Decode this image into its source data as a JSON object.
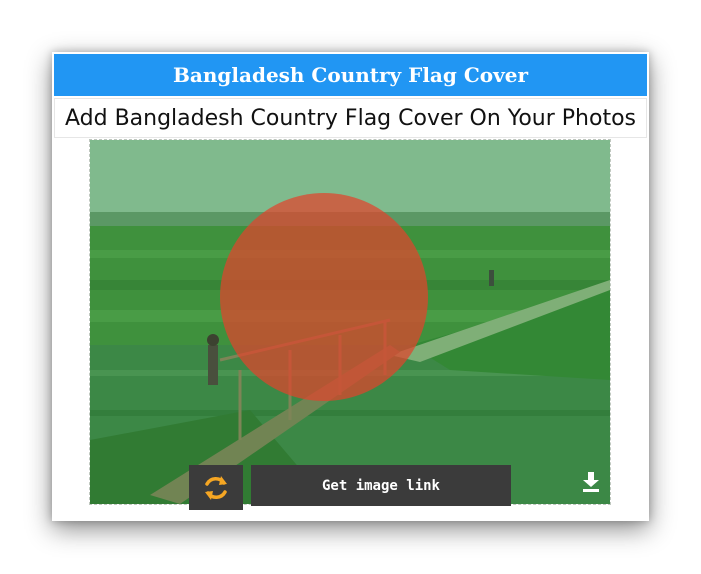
{
  "header": {
    "title": "Bangladesh Country Flag Cover"
  },
  "subtitle": {
    "text": "Add Bangladesh Country Flag Cover On Your Photos"
  },
  "preview": {
    "icons": {
      "download": "download-icon",
      "refresh": "refresh-icon"
    },
    "colors": {
      "overlay_green": "#006a4e",
      "circle_red": "#f42a41"
    }
  },
  "actions": {
    "get_link_label": "Get image link"
  },
  "colors": {
    "header_bg": "#2196f3",
    "button_bg": "#3b3b3b",
    "refresh_icon": "#f5a623"
  }
}
